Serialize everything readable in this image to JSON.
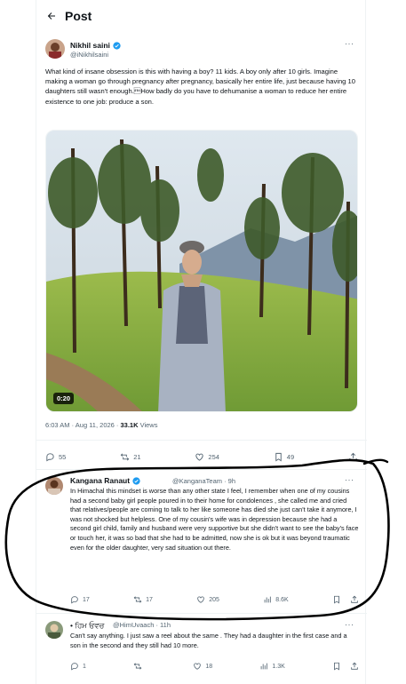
{
  "header": {
    "title": "Post"
  },
  "main_post": {
    "author_name": "Nikhil saini",
    "handle": "@iNikhilsaini",
    "text": "What kind of insane obsession is this with having a boy? 11 kids. A boy only after 10 girls. Imagine making a woman go through pregnancy after pregnancy, basically her entire life, just because having 10 daughters still wasn't enough.\u0002How badly do you have to dehumanise a woman to reduce her entire existence to one job: produce a son.",
    "video_duration": "0:20",
    "timestamp": "6:03 AM · Aug 11, 2026 · ",
    "views_count": "33.1K",
    "views_label": " Views",
    "stats": {
      "replies": "55",
      "reposts": "21",
      "likes": "254",
      "bookmarks": "49"
    }
  },
  "replies": [
    {
      "author_name": "Kangana Ranaut",
      "handle": "@KanganaTeam · 9h",
      "text": "In Himachal this mindset is worse than any other state I feel, I remember when one of my cousins had a second baby girl people poured in to their home for condolences , she called me and cried that relatives/people are coming to talk to her like someone has died she just can't take it anymore, I was not shocked but helpless. One of my cousin's wife was in depression because she had a second girl child, family and husband were very supportive but she didn't want to see the baby's face or touch her, it was so bad that she had to be admitted, now she is ok but it was beyond traumatic even for the older daughter, very sad situation out there.",
      "stats": {
        "replies": "17",
        "reposts": "17",
        "likes": "205",
        "views": "8.6K"
      }
    },
    {
      "author_name": "• ਹਿਮ ਓਵਚ",
      "handle": "@HimUvaach · 11h",
      "text": "Can't say anything. I just saw a reel about the same . They had a daughter in the first case and a son in the second and they still had 10 more.",
      "stats": {
        "replies": "1",
        "reposts": "",
        "likes": "18",
        "views": "1.3K"
      }
    }
  ],
  "colors": {
    "text": "#0f1419",
    "muted": "#536471",
    "verified": "#1d9bf0",
    "annotation": "#000000"
  },
  "icons": [
    "back-arrow-icon",
    "verified-icon",
    "more-icon",
    "reply-icon",
    "repost-icon",
    "like-icon",
    "views-icon",
    "bookmark-icon",
    "share-icon"
  ]
}
